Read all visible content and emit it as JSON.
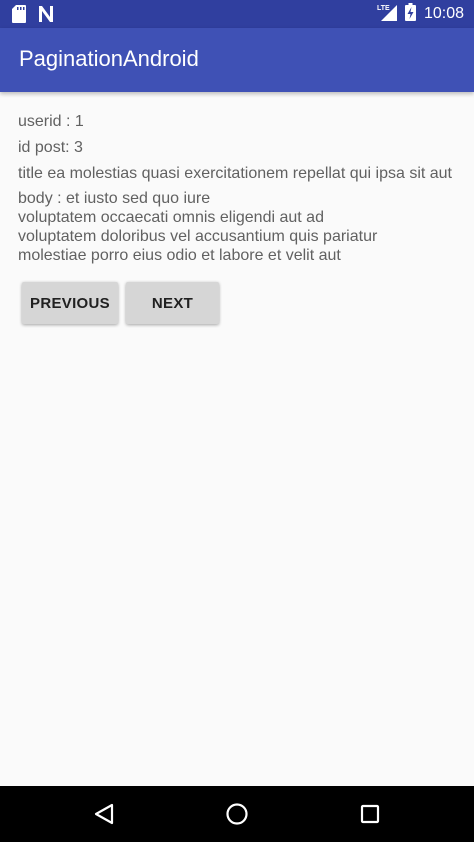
{
  "status_bar": {
    "time": "10:08",
    "network_label": "LTE",
    "icons": [
      "sd-card-icon",
      "notification-n-icon",
      "lte-signal-icon",
      "battery-charging-icon"
    ]
  },
  "app_bar": {
    "title": "PaginationAndroid",
    "color": "#3f51b5",
    "status_color": "#303f9f"
  },
  "post": {
    "userid": "userid : 1",
    "id_post": "id post: 3",
    "title": "title ea molestias quasi exercitationem repellat qui ipsa sit aut",
    "body": "body : et iusto sed quo iure\nvoluptatem occaecati omnis eligendi aut ad\nvoluptatem doloribus vel accusantium quis pariatur\nmolestiae porro eius odio et labore et velit aut"
  },
  "buttons": {
    "previous": "PREVIOUS",
    "next": "NEXT"
  },
  "nav_bar": {
    "icons": [
      "back-icon",
      "home-icon",
      "recents-icon"
    ]
  }
}
